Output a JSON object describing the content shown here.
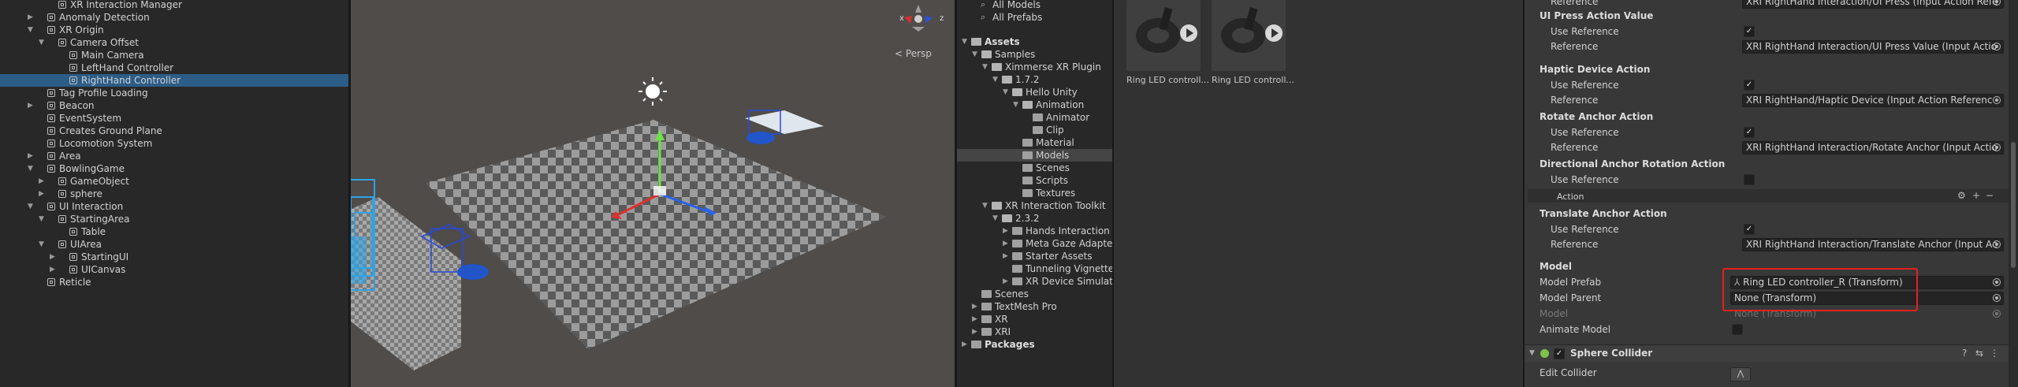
{
  "hierarchy": {
    "items": [
      {
        "label": "XR Interaction Manager",
        "arrow": "",
        "cube": true
      },
      {
        "label": "Anomaly Detection",
        "arrow": "▶",
        "cube": true
      },
      {
        "label": "XR Origin",
        "arrow": "▼",
        "cube": true
      },
      {
        "label": "Camera Offset",
        "arrow": "▼",
        "cube": true
      },
      {
        "label": "Main Camera",
        "arrow": "",
        "cube": true
      },
      {
        "label": "LeftHand Controller",
        "arrow": "",
        "cube": true
      },
      {
        "label": "RightHand Controller",
        "arrow": "",
        "cube": true,
        "selected": true
      },
      {
        "label": "Tag Profile Loading",
        "arrow": "",
        "cube": true
      },
      {
        "label": "Beacon",
        "arrow": "▶",
        "cube": true
      },
      {
        "label": "EventSystem",
        "arrow": "",
        "cube": true
      },
      {
        "label": "Creates Ground Plane",
        "arrow": "",
        "cube": true
      },
      {
        "label": "Locomotion System",
        "arrow": "",
        "cube": true
      },
      {
        "label": "Area",
        "arrow": "▶",
        "cube": true
      },
      {
        "label": "BowlingGame",
        "arrow": "▼",
        "cube": true
      },
      {
        "label": "GameObject",
        "arrow": "▶",
        "cube": true
      },
      {
        "label": "sphere",
        "arrow": "▶",
        "cube": true
      },
      {
        "label": "UI Interaction",
        "arrow": "▼",
        "cube": true
      },
      {
        "label": "StartingArea",
        "arrow": "▼",
        "cube": true
      },
      {
        "label": "Table",
        "arrow": "",
        "cube": true
      },
      {
        "label": "UIArea",
        "arrow": "▼",
        "cube": true
      },
      {
        "label": "StartingUI",
        "arrow": "▶",
        "cube": true
      },
      {
        "label": "UICanvas",
        "arrow": "▶",
        "cube": true
      },
      {
        "label": "Reticle",
        "arrow": "",
        "cube": true
      }
    ]
  },
  "scene": {
    "projection_label": "Persp",
    "gizmo": {
      "x": "x",
      "z": "z"
    }
  },
  "project": {
    "favorites": [
      "All Models",
      "All Prefabs"
    ],
    "items": [
      {
        "label": "Assets",
        "arrow": "▼",
        "bold": true
      },
      {
        "label": "Samples",
        "arrow": "▼"
      },
      {
        "label": "Ximmerse XR Plugin",
        "arrow": "▼"
      },
      {
        "label": "1.7.2",
        "arrow": "▼"
      },
      {
        "label": "Hello Unity",
        "arrow": "▼"
      },
      {
        "label": "Animation",
        "arrow": "▼"
      },
      {
        "label": "Animator",
        "arrow": ""
      },
      {
        "label": "Clip",
        "arrow": ""
      },
      {
        "label": "Material",
        "arrow": ""
      },
      {
        "label": "Models",
        "arrow": "",
        "selected": true
      },
      {
        "label": "Scenes",
        "arrow": ""
      },
      {
        "label": "Scripts",
        "arrow": ""
      },
      {
        "label": "Textures",
        "arrow": ""
      },
      {
        "label": "XR Interaction Toolkit",
        "arrow": "▼"
      },
      {
        "label": "2.3.2",
        "arrow": "▼"
      },
      {
        "label": "Hands Interaction D",
        "arrow": "▶"
      },
      {
        "label": "Meta Gaze Adapter",
        "arrow": "▶"
      },
      {
        "label": "Starter Assets",
        "arrow": "▶"
      },
      {
        "label": "Tunneling Vignette",
        "arrow": ""
      },
      {
        "label": "XR Device Simulato",
        "arrow": "▶"
      },
      {
        "label": "Scenes",
        "arrow": ""
      },
      {
        "label": "TextMesh Pro",
        "arrow": "▶"
      },
      {
        "label": "XR",
        "arrow": "▶"
      },
      {
        "label": "XRI",
        "arrow": "▶"
      },
      {
        "label": "Packages",
        "arrow": "▶",
        "bold": true
      }
    ]
  },
  "assets": {
    "thumbs": [
      {
        "label": "Ring LED controll..."
      },
      {
        "label": "Ring LED controll..."
      }
    ]
  },
  "inspector": {
    "top_reference": "XRI RightHand Interaction/UI Press (Input Action Refe",
    "ui_press_value": {
      "header": "UI Press Action Value",
      "use_ref": "Use Reference",
      "ref": "Reference",
      "ref_value": "XRI RightHand Interaction/UI Press Value (Input Actio"
    },
    "haptic": {
      "header": "Haptic Device Action",
      "use_ref": "Use Reference",
      "ref": "Reference",
      "ref_value": "XRI RightHand/Haptic Device (Input Action Referenc"
    },
    "rotate": {
      "header": "Rotate Anchor Action",
      "use_ref": "Use Reference",
      "ref": "Reference",
      "ref_value": "XRI RightHand Interaction/Rotate Anchor (Input Actio"
    },
    "directional": {
      "header": "Directional Anchor Rotation Action",
      "use_ref": "Use Reference",
      "action": "Action"
    },
    "translate": {
      "header": "Translate Anchor Action",
      "use_ref": "Use Reference",
      "ref": "Reference",
      "ref_value": "XRI RightHand Interaction/Translate Anchor (Input Ac"
    },
    "model": {
      "header": "Model",
      "prefab_label": "Model Prefab",
      "prefab_value": "Ring LED controller_R (Transform)",
      "parent_label": "Model Parent",
      "parent_value": "None (Transform)",
      "model_label": "Model",
      "model_value": "None (Transform)",
      "animate_label": "Animate Model"
    },
    "sphere_collider": {
      "title": "Sphere Collider",
      "edit": "Edit Collider"
    }
  }
}
